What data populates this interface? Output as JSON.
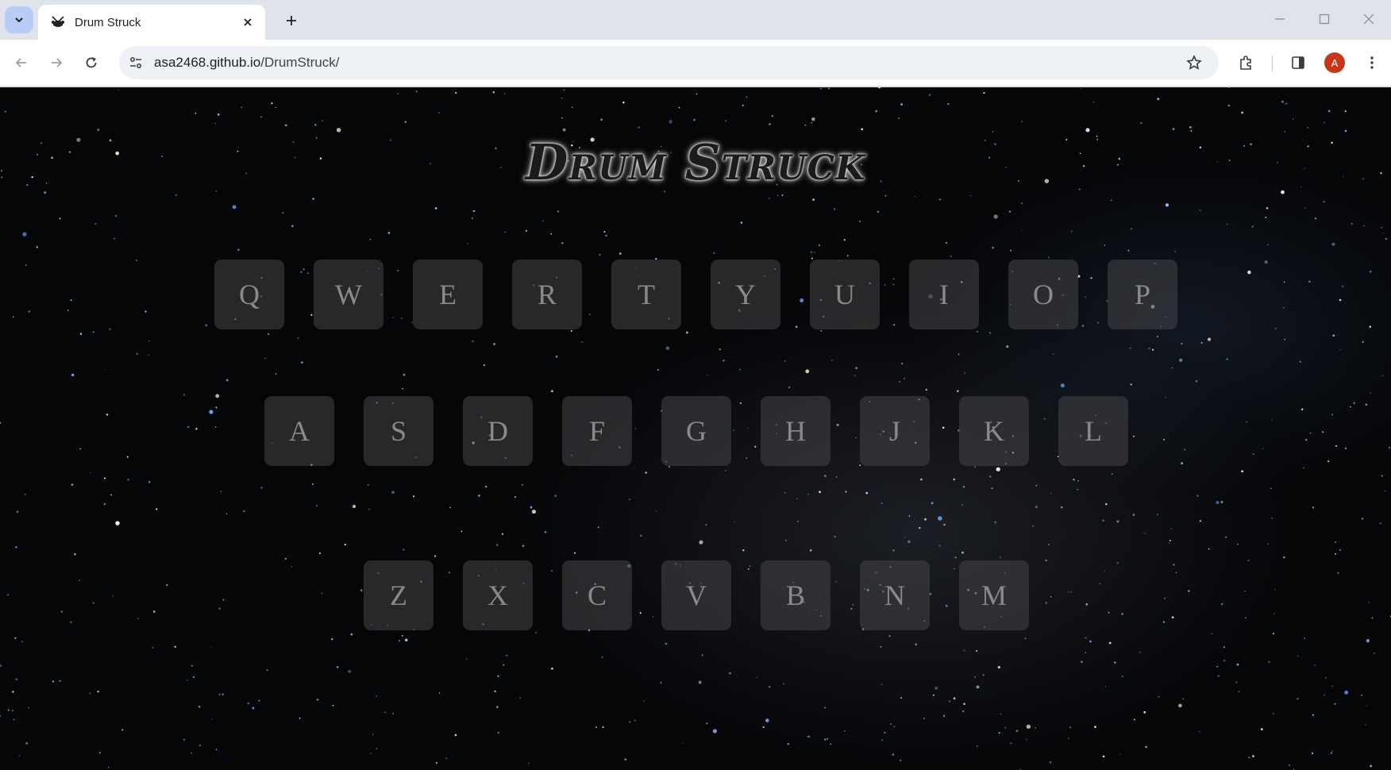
{
  "browser": {
    "tab_title": "Drum Struck",
    "url_host": "asa2468.github.io",
    "url_path": "/DrumStruck/",
    "profile_initial": "A"
  },
  "page": {
    "title": "Drum Struck",
    "rows": [
      [
        "Q",
        "W",
        "E",
        "R",
        "T",
        "Y",
        "U",
        "I",
        "O",
        "P"
      ],
      [
        "A",
        "S",
        "D",
        "F",
        "G",
        "H",
        "J",
        "K",
        "L"
      ],
      [
        "Z",
        "X",
        "C",
        "V",
        "B",
        "N",
        "M"
      ]
    ]
  },
  "colors": {
    "accent_tab_menu": "#b8cdf5",
    "avatar": "#c5371c",
    "background": "#050608",
    "key": "#3a3a3c"
  }
}
